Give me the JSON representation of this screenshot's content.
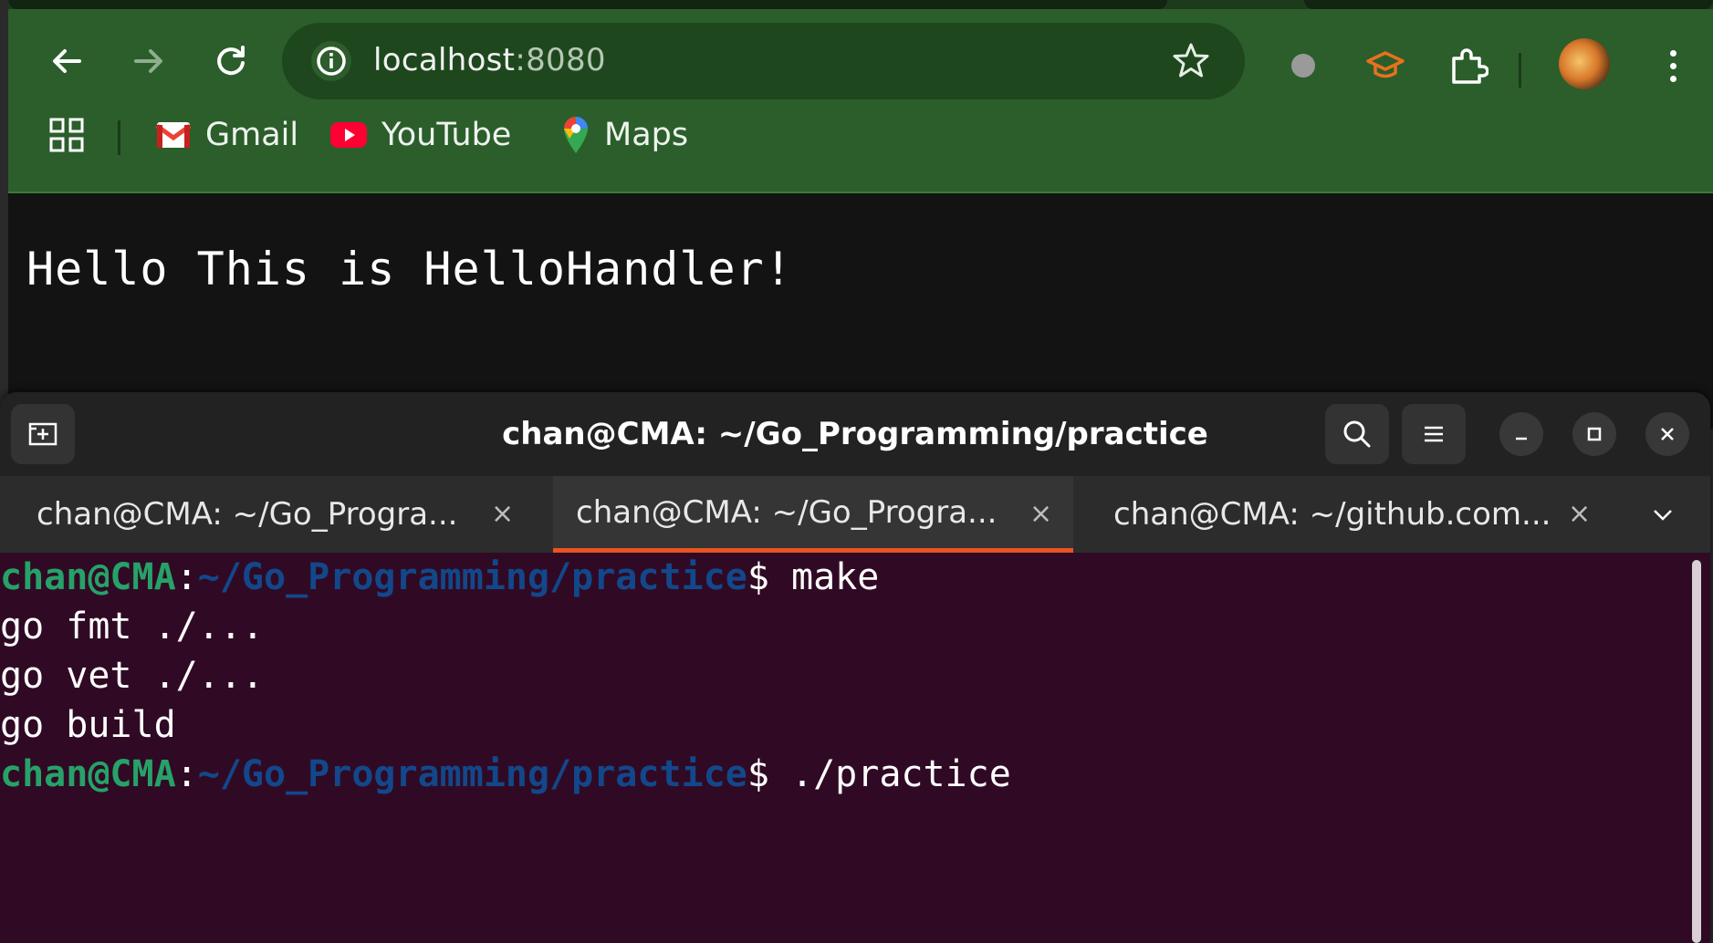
{
  "browser": {
    "url_host": "localhost",
    "url_port": ":8080",
    "bookmarks": {
      "gmail": "Gmail",
      "youtube": "YouTube",
      "maps": "Maps"
    },
    "page_text": "Hello This is HelloHandler!",
    "theme_color": "#2b5e2b"
  },
  "terminal": {
    "title": "chan@CMA: ~/Go_Programming/practice",
    "tabs": [
      {
        "label": "chan@CMA: ~/Go_Progra..."
      },
      {
        "label": "chan@CMA: ~/Go_Progra..."
      },
      {
        "label": "chan@CMA: ~/github.com..."
      }
    ],
    "tab_close": "×",
    "prompt_user": "chan@CMA",
    "prompt_sep": ":",
    "prompt_path": "~/Go_Programming/practice",
    "prompt_dollar": "$ ",
    "lines": {
      "cmd1": "make",
      "out1": "go fmt ./...",
      "out2": "go vet ./...",
      "out3": "go build",
      "cmd2": "./practice"
    },
    "colors": {
      "background": "#300a24",
      "user": "#26a269",
      "path": "#12488b",
      "accent": "#e95420"
    }
  }
}
